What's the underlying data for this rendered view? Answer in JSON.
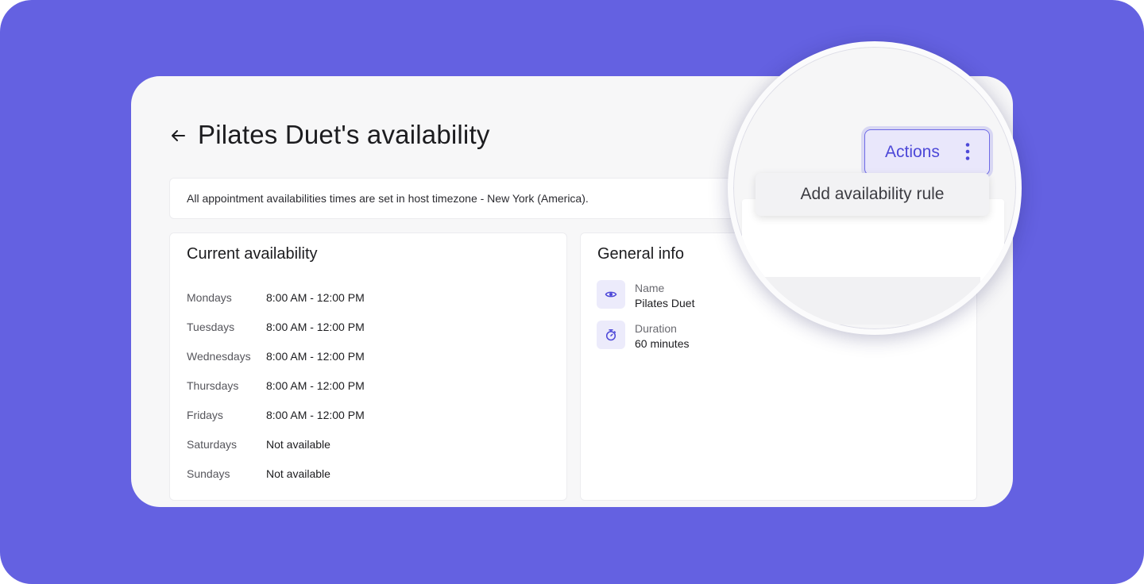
{
  "header": {
    "title": "Pilates Duet's availability"
  },
  "timezone_notice": "All appointment availabilities times are set in host timezone - New York (America).",
  "current_availability": {
    "title": "Current availability",
    "rows": [
      {
        "day": "Mondays",
        "time": "8:00 AM - 12:00 PM"
      },
      {
        "day": "Tuesdays",
        "time": "8:00 AM - 12:00 PM"
      },
      {
        "day": "Wednesdays",
        "time": "8:00 AM - 12:00 PM"
      },
      {
        "day": "Thursdays",
        "time": "8:00 AM - 12:00 PM"
      },
      {
        "day": "Fridays",
        "time": "8:00 AM - 12:00 PM"
      },
      {
        "day": "Saturdays",
        "time": "Not available"
      },
      {
        "day": "Sundays",
        "time": "Not available"
      }
    ]
  },
  "general_info": {
    "title": "General info",
    "name": {
      "label": "Name",
      "value": "Pilates Duet",
      "icon": "eye-icon"
    },
    "duration": {
      "label": "Duration",
      "value": "60 minutes",
      "icon": "stopwatch-icon"
    }
  },
  "actions_menu": {
    "label": "Actions",
    "items": [
      "Add availability rule"
    ]
  },
  "colors": {
    "background": "#6461e1",
    "accent": "#4d48d8",
    "icon_tile": "#ecebfb"
  }
}
